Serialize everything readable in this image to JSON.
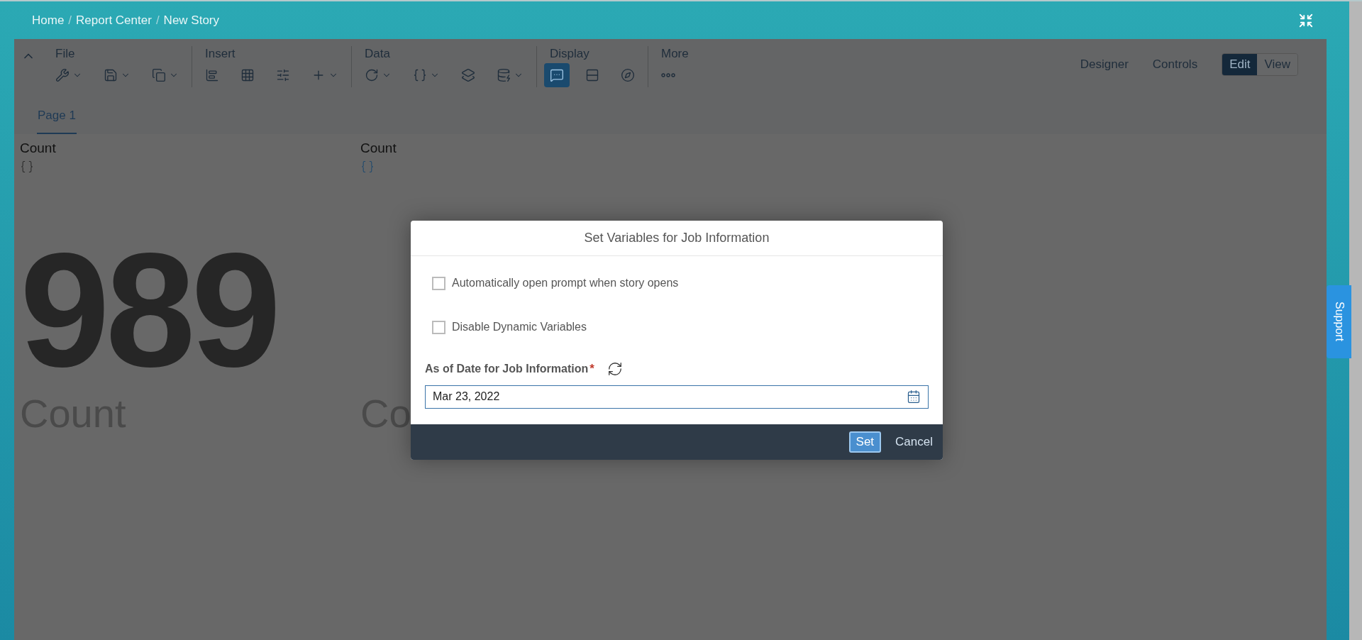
{
  "breadcrumb": {
    "separator": "/",
    "items": [
      {
        "label": "Home"
      },
      {
        "label": "Report Center"
      },
      {
        "label": "New Story"
      }
    ]
  },
  "toolbar": {
    "groups": [
      {
        "label": "File",
        "tools": [
          {
            "kind": "wrench",
            "menu": true,
            "selected": false
          },
          {
            "kind": "save",
            "menu": true,
            "selected": false
          },
          {
            "kind": "copy",
            "menu": true,
            "selected": false
          }
        ]
      },
      {
        "label": "Insert",
        "tools": [
          {
            "kind": "chart",
            "menu": false,
            "selected": false
          },
          {
            "kind": "table",
            "menu": false,
            "selected": false
          },
          {
            "kind": "sliders",
            "menu": false,
            "selected": false
          },
          {
            "kind": "plus",
            "menu": true,
            "selected": false
          }
        ]
      },
      {
        "label": "Data",
        "tools": [
          {
            "kind": "refresh",
            "menu": true,
            "selected": false
          },
          {
            "kind": "braces",
            "menu": true,
            "selected": false
          },
          {
            "kind": "layers",
            "menu": false,
            "selected": false
          },
          {
            "kind": "database",
            "menu": true,
            "selected": false
          }
        ]
      },
      {
        "label": "Display",
        "tools": [
          {
            "kind": "comment",
            "menu": false,
            "selected": true
          },
          {
            "kind": "split",
            "menu": false,
            "selected": false
          },
          {
            "kind": "compass",
            "menu": false,
            "selected": false
          }
        ]
      },
      {
        "label": "More",
        "tools": [
          {
            "kind": "more",
            "menu": false,
            "selected": false
          }
        ]
      }
    ],
    "modes": [
      {
        "label": "Designer"
      },
      {
        "label": "Controls"
      }
    ],
    "toggle": [
      {
        "label": "Edit",
        "selected": true
      },
      {
        "label": "View",
        "selected": false
      }
    ]
  },
  "page_tabs": [
    {
      "label": "Page 1",
      "selected": true
    }
  ],
  "tiles": [
    {
      "title": "Count",
      "value": "989",
      "caption": "Count"
    },
    {
      "title": "Count",
      "caption": "Co"
    }
  ],
  "dialog": {
    "title": "Set Variables for Job Information",
    "options": [
      {
        "label": "Automatically open prompt when story opens",
        "checked": false
      },
      {
        "label": "Disable Dynamic Variables",
        "checked": false
      }
    ],
    "field": {
      "label": "As of Date for Job Information",
      "required": true,
      "required_mark": "*",
      "value": "Mar 23, 2022"
    },
    "buttons": [
      {
        "label": "Set",
        "kind": "primary"
      },
      {
        "label": "Cancel",
        "kind": "secondary"
      }
    ]
  },
  "support": "Support"
}
